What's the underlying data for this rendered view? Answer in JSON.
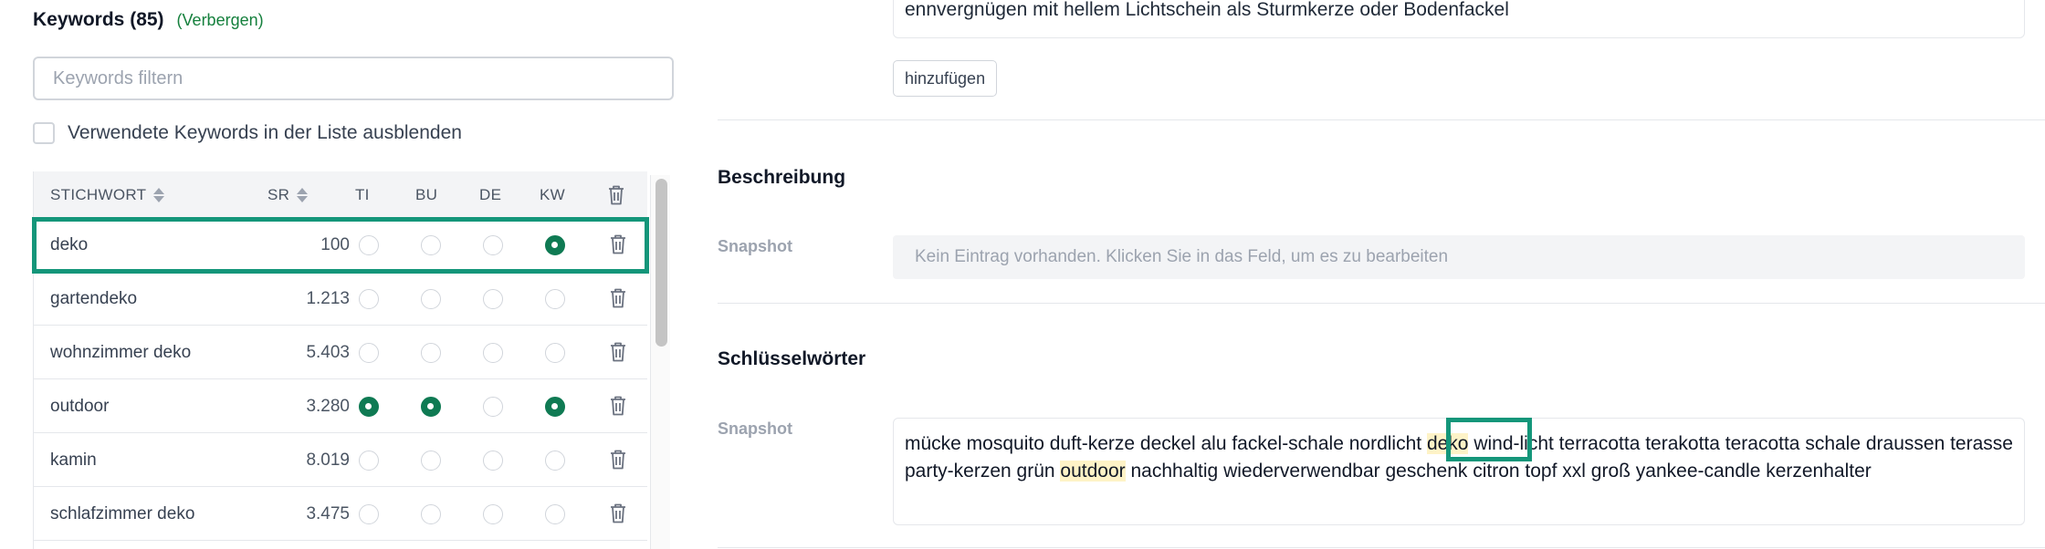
{
  "keywords_panel": {
    "title": "Keywords (85)",
    "hide_link": "(Verbergen)",
    "filter_placeholder": "Keywords filtern",
    "hide_used_label": "Verwendete Keywords in der Liste ausblenden",
    "columns": [
      "STICHWORT",
      "SR",
      "TI",
      "BU",
      "DE",
      "KW"
    ],
    "rows": [
      {
        "keyword": "deko",
        "sr": "100",
        "ti": false,
        "bu": false,
        "de": false,
        "kw": true,
        "selected": true
      },
      {
        "keyword": "gartendeko",
        "sr": "1.213",
        "ti": false,
        "bu": false,
        "de": false,
        "kw": false
      },
      {
        "keyword": "wohnzimmer deko",
        "sr": "5.403",
        "ti": false,
        "bu": false,
        "de": false,
        "kw": false
      },
      {
        "keyword": "outdoor",
        "sr": "3.280",
        "ti": true,
        "bu": true,
        "de": false,
        "kw": true
      },
      {
        "keyword": "kamin",
        "sr": "8.019",
        "ti": false,
        "bu": false,
        "de": false,
        "kw": false
      },
      {
        "keyword": "schlafzimmer deko",
        "sr": "3.475",
        "ti": false,
        "bu": false,
        "de": false,
        "kw": false
      }
    ]
  },
  "editor": {
    "top_text": "ennvergnügen mit hellem Lichtschein als Sturmkerze oder Bodenfackel",
    "add_button": "hinzufügen",
    "description_title": "Beschreibung",
    "description_snapshot_label": "Snapshot",
    "description_empty": "Kein Eintrag vorhanden. Klicken Sie in das Feld, um es zu bearbeiten",
    "keywords_title": "Schlüsselwörter",
    "keywords_snapshot_label": "Snapshot",
    "keywords_text": {
      "part1": "mücke mosquito duft-kerze deckel alu fackel-schale nordlicht ",
      "hl1": "deko",
      "part2": " wind-licht terracotta terakotta teracotta schale draussen terasse party-kerzen grün ",
      "hl2": "outdoor",
      "part3": " nachhaltig wiederverwendbar geschenk citron topf xxl groß yankee-candle kerzenhalter"
    }
  },
  "colors": {
    "accent_green": "#0f7a53",
    "selection_outline": "#14967a",
    "highlight": "#fef3c7"
  }
}
